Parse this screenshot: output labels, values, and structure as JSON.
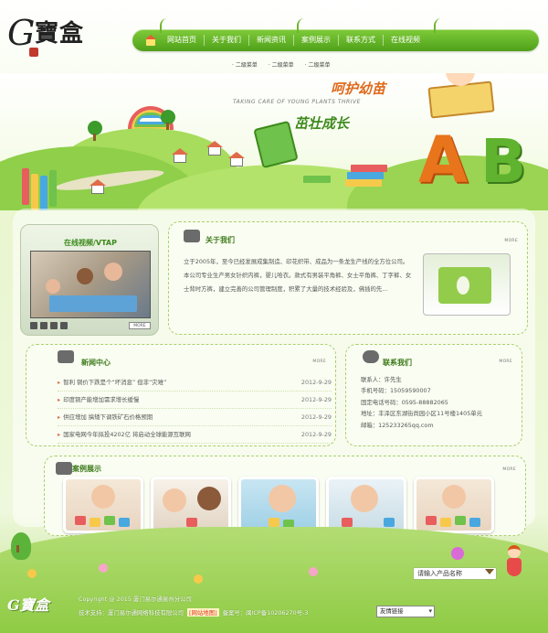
{
  "logo": {
    "text": "G寶盒"
  },
  "nav": {
    "items": [
      "网站首页",
      "关于我们",
      "新闻资讯",
      "案例展示",
      "联系方式",
      "在线视频"
    ]
  },
  "subnav": [
    "· 二级菜单",
    "· 二级菜单",
    "· 二级菜单"
  ],
  "banner": {
    "slogan_cn1": "呵护幼苗",
    "slogan_en": "TAKING CARE OF YOUNG PLANTS THRIVE",
    "slogan_cn2": "茁壮成长",
    "letter_a": "A",
    "letter_b": "B"
  },
  "video": {
    "title": "在线视频/VTAP",
    "more": "MORE"
  },
  "about": {
    "title": "关于我们",
    "more": "MORE",
    "text": "立于2005年，至今已经发展成集制造、印花织带、成品为一条龙生产线的全方位公司。本公司专业生产男女针织内裤，婴儿哈衣。款式有男装平角裤、女士平角裤、丁字裤、女士背时方裤，建立完善的公司管理制度，积累了大量的技术经验及，佛插的先..."
  },
  "news": {
    "title": "新闻中心",
    "more": "MORE",
    "items": [
      {
        "title": "智利 铜价下跌是个“坏消息” 但非“灾难”",
        "date": "2012-9-29"
      },
      {
        "title": "印度铜产能增加需求增长缓慢",
        "date": "2012-9-29"
      },
      {
        "title": "供应增加 搞矮下调铁矿石价格预期",
        "date": "2012-9-29"
      },
      {
        "title": "国家电网今年拟投4202亿 将启动全球能源互联网",
        "date": "2012-9-29"
      }
    ]
  },
  "contact": {
    "title": "联系我们",
    "more": "MORE",
    "lines": [
      "联系人：许先生",
      "手机号码：15059590007",
      "固定电话号码：0595-88882065",
      "地址：丰泽区东湖街尚园小区11号楼1405单元",
      "邮箱：125233265qq.com"
    ]
  },
  "cases": {
    "title": "案例展示",
    "more": "MORE"
  },
  "search": {
    "placeholder": "请输入产品名称"
  },
  "footer": {
    "logo": "G寶盒",
    "copyright": "Copyright @ 2015 厦门易尔通泉州分公司",
    "support": "技术支持：厦门易尔通网络科技有限公司",
    "sitemap": "[网站地图]",
    "icp": "备案号：闽ICP备10206270号-3",
    "friend_links": "友情链接"
  },
  "colors": {
    "accent": "#4fa11a",
    "title_green": "#3d7a1a",
    "orange": "#e86a1c"
  }
}
